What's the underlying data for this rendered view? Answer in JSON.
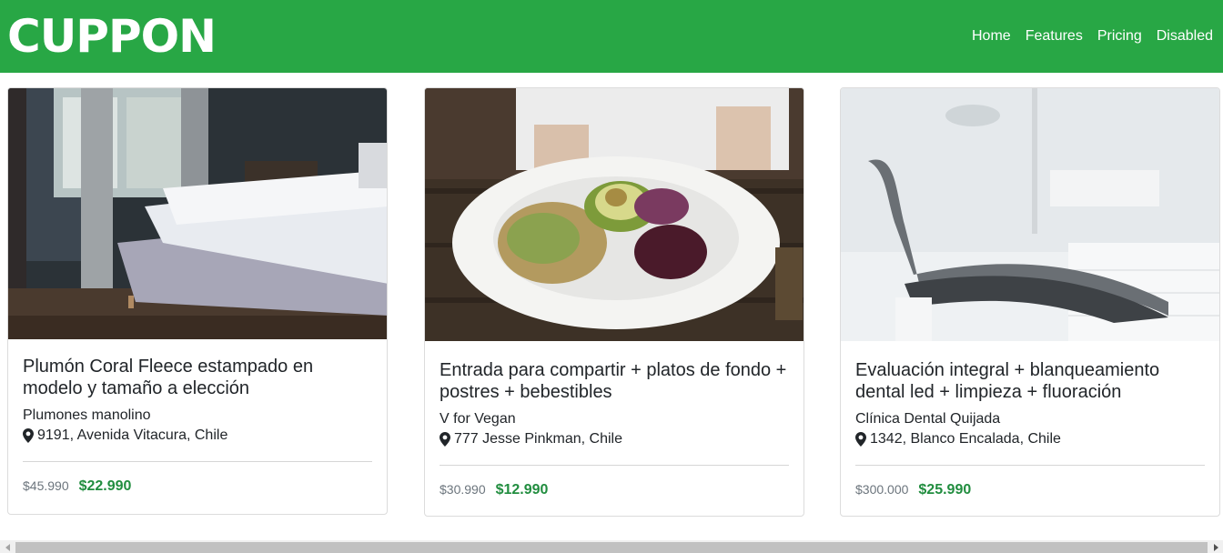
{
  "brand": "CUPPON",
  "nav": [
    {
      "label": "Home"
    },
    {
      "label": "Features"
    },
    {
      "label": "Pricing"
    },
    {
      "label": "Disabled"
    }
  ],
  "cards": [
    {
      "title": "Plumón Coral Fleece estampado en modelo y tamaño a elección",
      "merchant": "Plumones manolino",
      "address": "9191, Avenida Vitacura, Chile",
      "old_price": "$45.990",
      "new_price": "$22.990",
      "image": "bedroom-photo"
    },
    {
      "title": "Entrada para compartir + platos de fondo + postres + bebestibles",
      "merchant": "V for Vegan",
      "address": "777 Jesse Pinkman, Chile",
      "old_price": "$30.990",
      "new_price": "$12.990",
      "image": "vegan-salad-photo"
    },
    {
      "title": "Evaluación integral + blanqueamiento dental led + limpieza + fluoración",
      "merchant": "Clínica Dental Quijada",
      "address": "1342, Blanco Encalada, Chile",
      "old_price": "$300.000",
      "new_price": "$25.990",
      "image": "dental-chair-photo"
    }
  ],
  "colors": {
    "navbar": "#28a745",
    "price_new": "#218d3f",
    "price_old": "#6c757d"
  }
}
